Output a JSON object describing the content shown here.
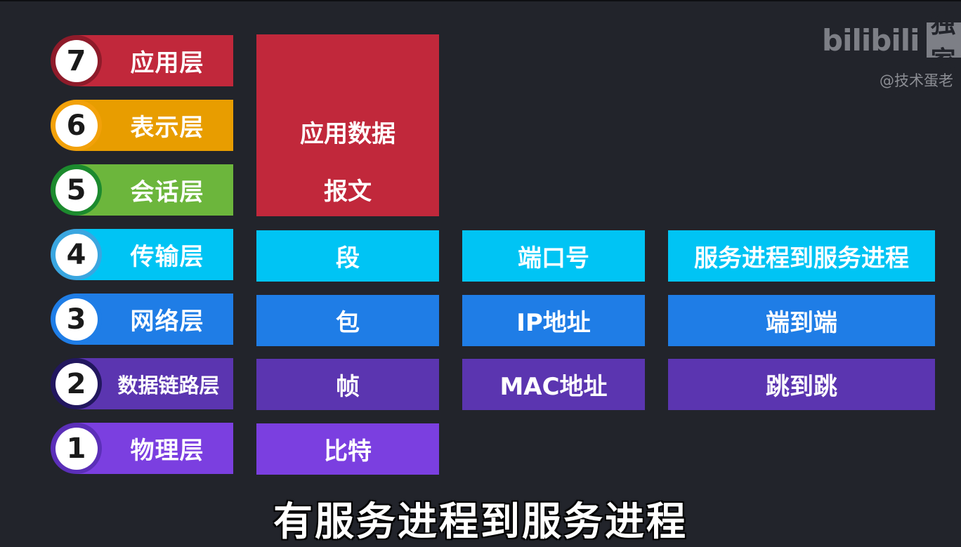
{
  "layers": [
    {
      "number": "7",
      "label": "应用层",
      "color": "#c1283b",
      "ring": "#8e1b2a"
    },
    {
      "number": "6",
      "label": "表示层",
      "color": "#e89d00",
      "ring": "#e89d00"
    },
    {
      "number": "5",
      "label": "会话层",
      "color": "#6cb63c",
      "ring": "#1c8a2e"
    },
    {
      "number": "4",
      "label": "传输层",
      "color": "#00c4f4",
      "ring": "#1db6e8"
    },
    {
      "number": "3",
      "label": "网络层",
      "color": "#1f7de6",
      "ring": "#1f7de6"
    },
    {
      "number": "2",
      "label": "数据链路层",
      "color": "#5b35b0",
      "ring": "#2a1a6e"
    },
    {
      "number": "1",
      "label": "物理层",
      "color": "#7b3fe0",
      "ring": "#5b2fb8"
    }
  ],
  "application_box": {
    "line1": "应用数据",
    "line2": "报文",
    "color": "#c1283b"
  },
  "units": {
    "transport": "段",
    "network": "包",
    "datalink": "帧",
    "physical": "比特"
  },
  "addresses": {
    "transport": "端口号",
    "network": "IP地址",
    "datalink": "MAC地址"
  },
  "scopes": {
    "transport": "服务进程到服务进程",
    "network": "端到端",
    "datalink": "跳到跳"
  },
  "watermark": {
    "logo": "bilibili",
    "tag": "独家",
    "author": "@技术蛋老"
  },
  "subtitle": "有服务进程到服务进程"
}
